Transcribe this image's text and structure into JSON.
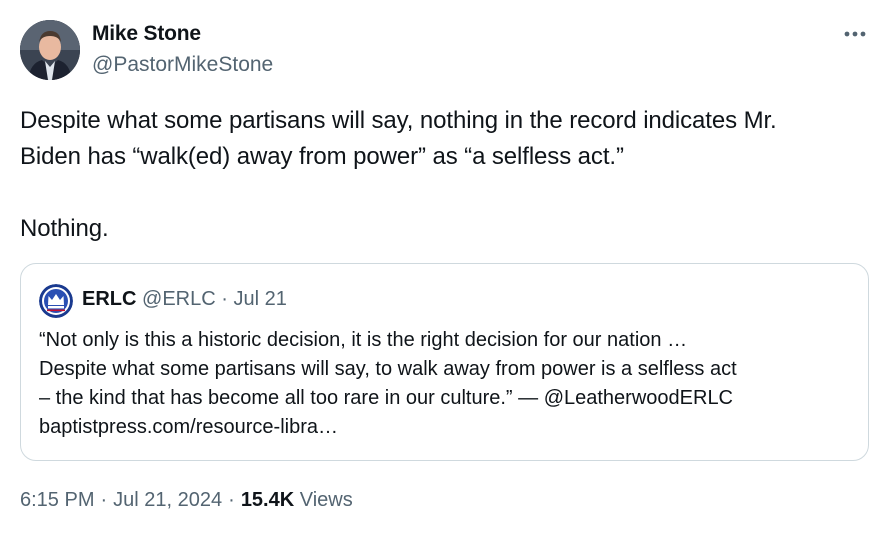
{
  "author": {
    "display_name": "Mike Stone",
    "handle": "@PastorMikeStone"
  },
  "more_icon": "more-horizontal-icon",
  "tweet": {
    "text": "Despite what some partisans will say, nothing in the record indicates Mr.\nBiden has “walk(ed) away from power” as “a selfless act.”\n\nNothing."
  },
  "quoted_tweet": {
    "display_name": "ERLC",
    "handle": "@ERLC",
    "separator": "·",
    "date": "Jul 21",
    "text": "“Not only is this a historic decision, it is the right decision for our nation …\nDespite what some partisans will say, to walk away from power is a selfless act\n– the kind that has become all too rare in our culture.” — @LeatherwoodERLC\nbaptistpress.com/resource-libra…",
    "logo_colors": {
      "ring": "#1a3a8f",
      "fill": "#2a4fb3",
      "crown": "#ffffff"
    }
  },
  "footer": {
    "time": "6:15 PM",
    "separator": "·",
    "date": "Jul 21, 2024",
    "views_count": "15.4K",
    "views_label": "Views"
  },
  "colors": {
    "text_primary": "#0f1419",
    "text_secondary": "#536471",
    "border": "#cfd9de"
  }
}
